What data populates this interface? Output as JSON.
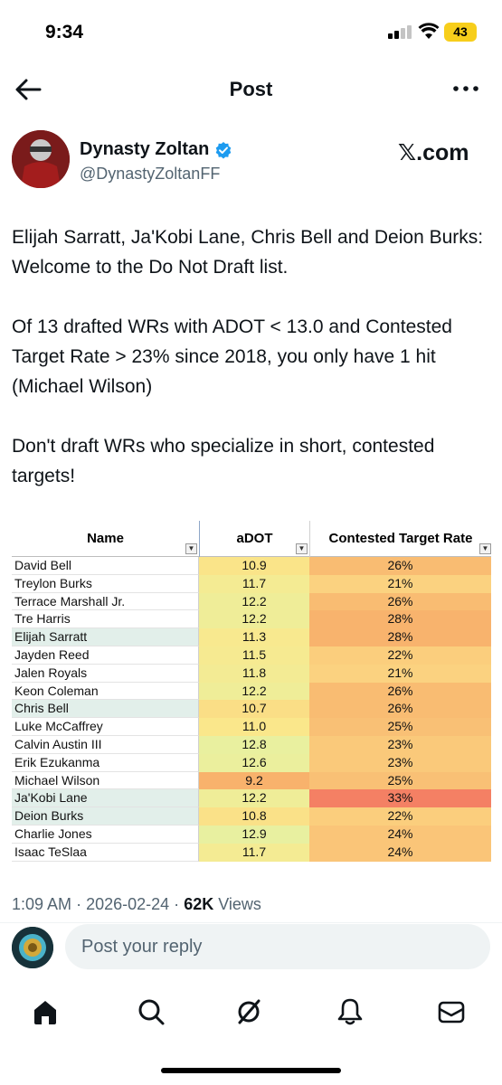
{
  "status_bar": {
    "time": "9:34",
    "battery": "43"
  },
  "header": {
    "title": "Post"
  },
  "author": {
    "name": "Dynasty Zoltan",
    "handle": "@DynastyZoltanFF",
    "source": "𝕏.com"
  },
  "tweet": {
    "paragraphs": [
      "Elijah Sarratt, Ja'Kobi Lane, Chris Bell and Deion Burks: Welcome to the Do Not Draft list.",
      "Of 13 drafted WRs with ADOT < 13.0 and Contested Target Rate > 23% since 2018, you only have 1 hit (Michael Wilson)",
      "Don't draft WRs who specialize in short, contested targets!"
    ]
  },
  "table": {
    "headers": {
      "name": "Name",
      "adot": "aDOT",
      "ctr": "Contested Target Rate"
    },
    "rows": [
      {
        "name": "David Bell",
        "adot": "10.9",
        "ctr": "26%",
        "highlight": false
      },
      {
        "name": "Treylon Burks",
        "adot": "11.7",
        "ctr": "21%",
        "highlight": false
      },
      {
        "name": "Terrace Marshall Jr.",
        "adot": "12.2",
        "ctr": "26%",
        "highlight": false
      },
      {
        "name": "Tre Harris",
        "adot": "12.2",
        "ctr": "28%",
        "highlight": false
      },
      {
        "name": "Elijah Sarratt",
        "adot": "11.3",
        "ctr": "28%",
        "highlight": true
      },
      {
        "name": "Jayden Reed",
        "adot": "11.5",
        "ctr": "22%",
        "highlight": false
      },
      {
        "name": "Jalen Royals",
        "adot": "11.8",
        "ctr": "21%",
        "highlight": false
      },
      {
        "name": "Keon Coleman",
        "adot": "12.2",
        "ctr": "26%",
        "highlight": false
      },
      {
        "name": "Chris Bell",
        "adot": "10.7",
        "ctr": "26%",
        "highlight": true
      },
      {
        "name": "Luke McCaffrey",
        "adot": "11.0",
        "ctr": "25%",
        "highlight": false
      },
      {
        "name": "Calvin Austin III",
        "adot": "12.8",
        "ctr": "23%",
        "highlight": false
      },
      {
        "name": "Erik Ezukanma",
        "adot": "12.6",
        "ctr": "23%",
        "highlight": false
      },
      {
        "name": "Michael Wilson",
        "adot": "9.2",
        "ctr": "25%",
        "highlight": false
      },
      {
        "name": "Ja'Kobi Lane",
        "adot": "12.2",
        "ctr": "33%",
        "highlight": true
      },
      {
        "name": "Deion Burks",
        "adot": "10.8",
        "ctr": "22%",
        "highlight": true
      },
      {
        "name": "Charlie Jones",
        "adot": "12.9",
        "ctr": "24%",
        "highlight": false
      },
      {
        "name": "Isaac TeSlaa",
        "adot": "11.7",
        "ctr": "24%",
        "highlight": false
      }
    ]
  },
  "meta": {
    "time": "1:09 AM",
    "date": "2026-02-24",
    "views": "62K",
    "views_label": "Views",
    "sep": "·"
  },
  "reply": {
    "placeholder": "Post your reply"
  },
  "colors": {
    "verified": "#1d9bf0",
    "highlight_row": "#e2efea",
    "text_secondary": "#536471"
  }
}
